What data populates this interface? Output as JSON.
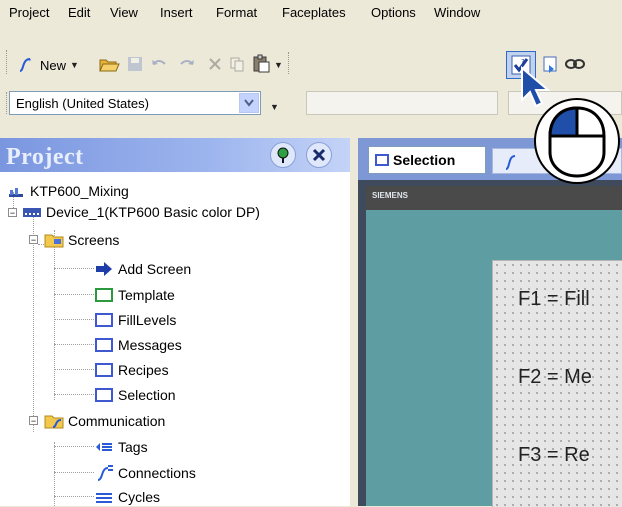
{
  "menu": [
    "Project",
    "Edit",
    "View",
    "Insert",
    "Format",
    "Faceplates",
    "Options",
    "Window"
  ],
  "toolbar": {
    "new_label": "New"
  },
  "language": {
    "selected": "English (United States)"
  },
  "project_panel": {
    "title": "Project"
  },
  "tree": {
    "project": "KTP600_Mixing",
    "device": "Device_1(KTP600 Basic color DP)",
    "screens": "Screens",
    "screen_items": [
      "Add Screen",
      "Template",
      "FillLevels",
      "Messages",
      "Recipes",
      "Selection"
    ],
    "communication": "Communication",
    "comm_items": [
      "Tags",
      "Connections",
      "Cycles"
    ]
  },
  "tabs": {
    "active": "Selection"
  },
  "screen": {
    "brand": "SIEMENS",
    "fkeys": [
      "F1 = Fill",
      "F2 = Me",
      "F3 = Re"
    ]
  },
  "colors": {
    "panel_header": "#7a96df",
    "workarea": "#5e9ea3",
    "highlight": "#316ac5"
  }
}
